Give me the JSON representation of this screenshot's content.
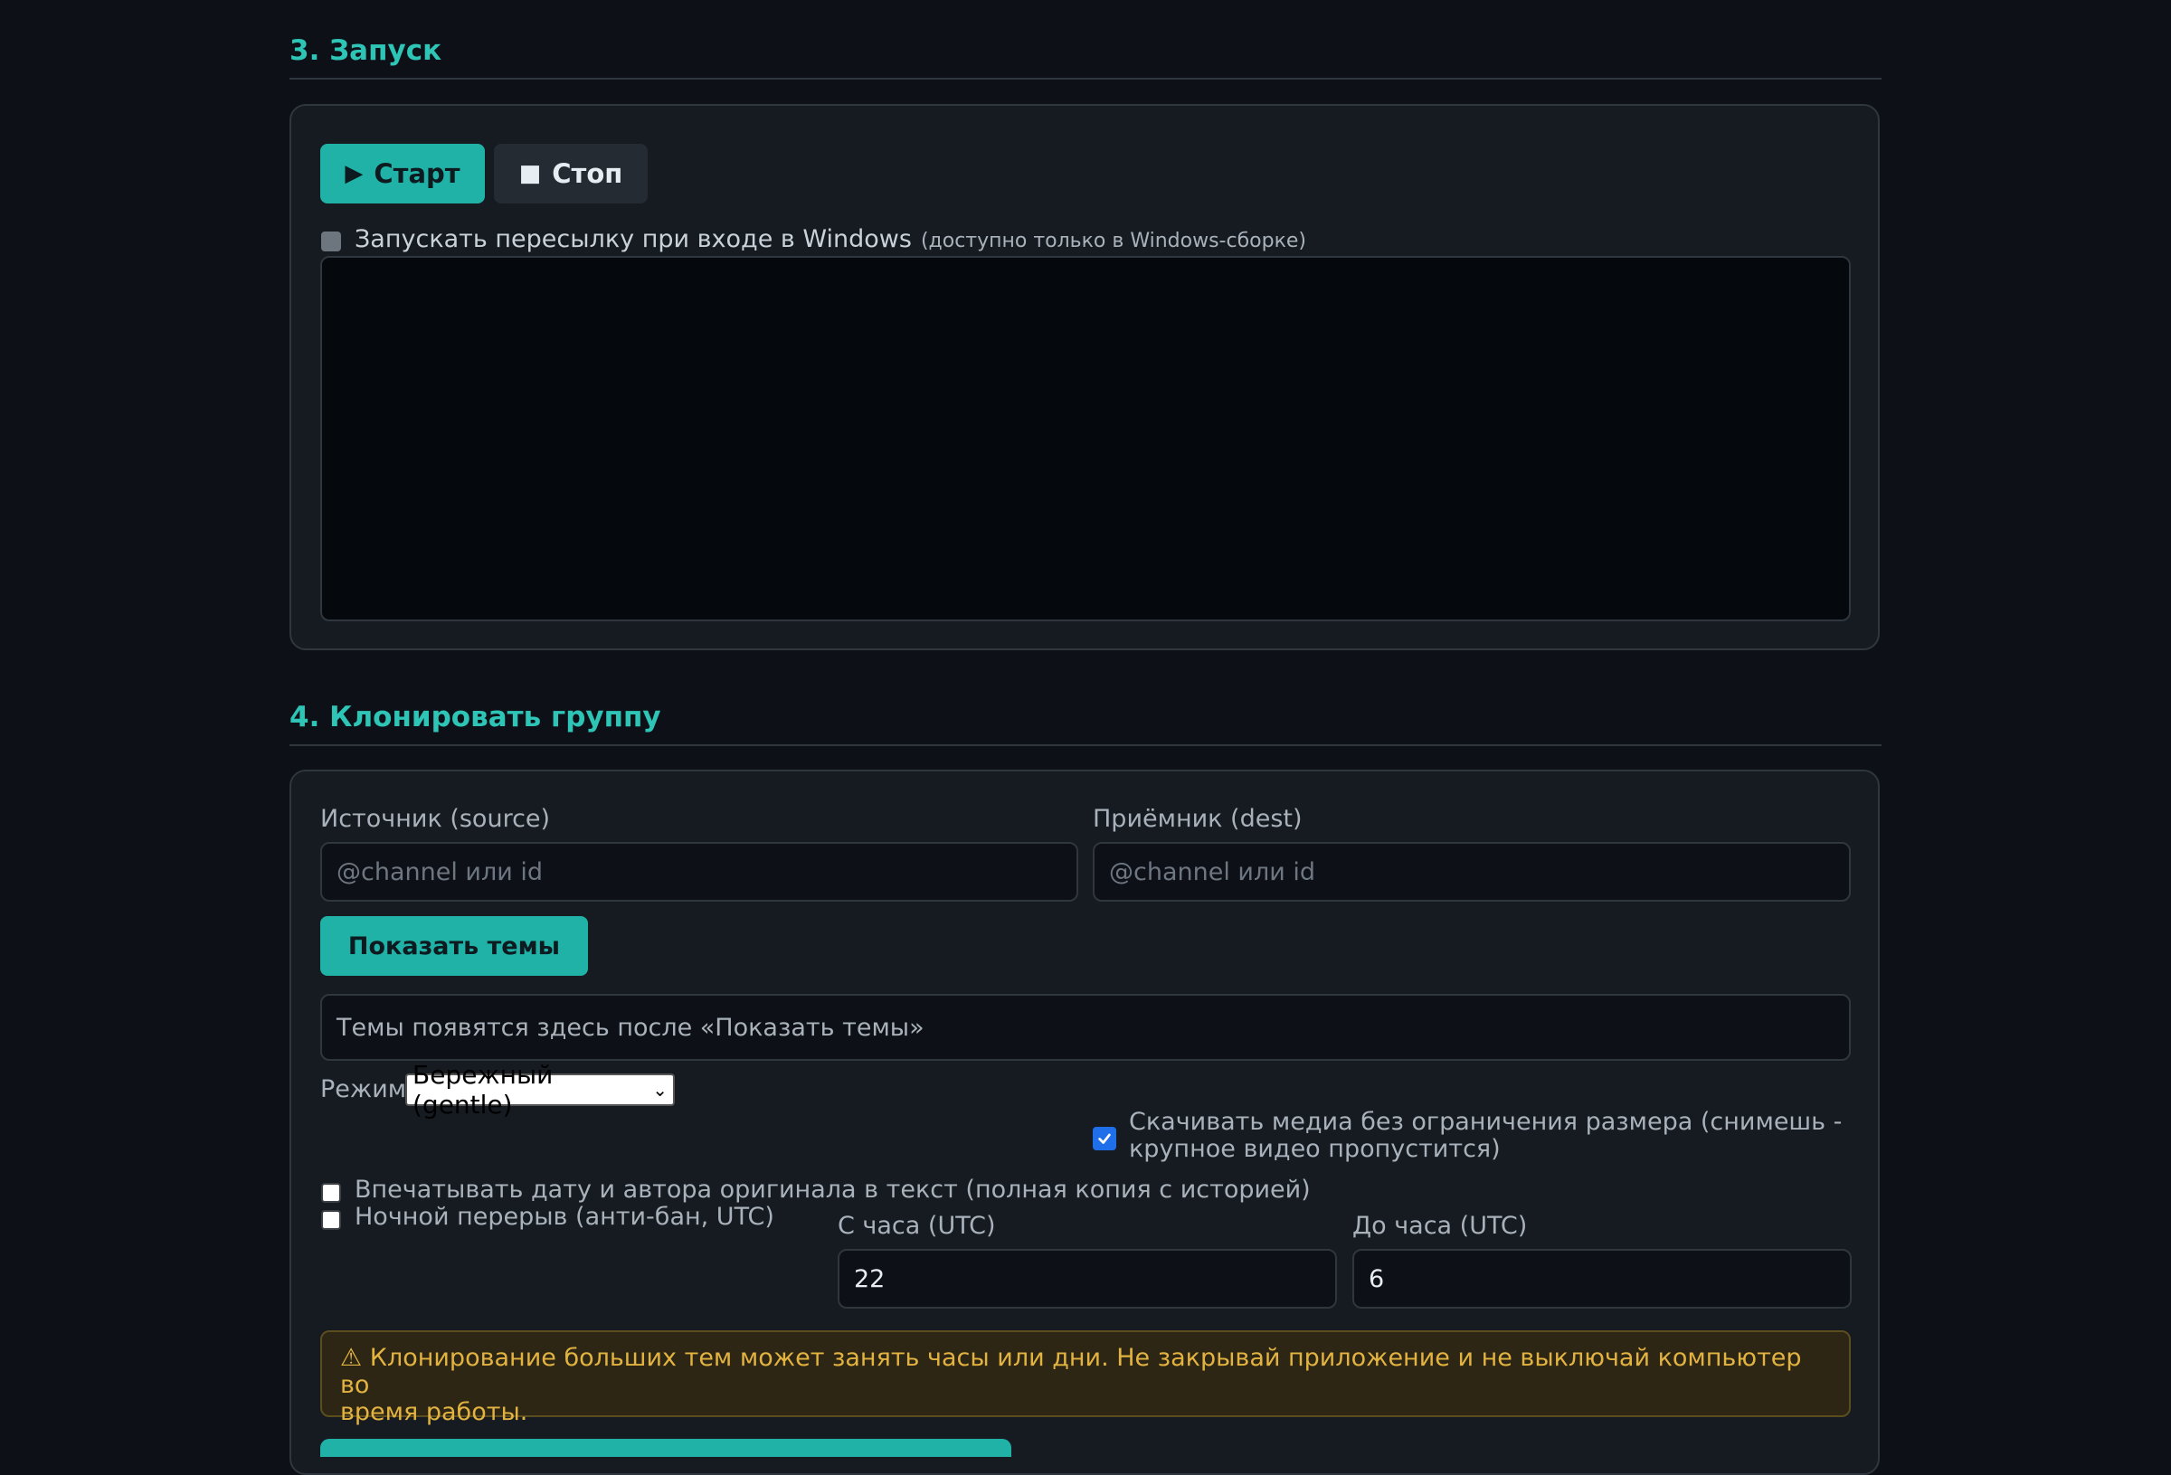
{
  "launch": {
    "title": "3. Запуск",
    "start_label": "Старт",
    "stop_label": "Стоп",
    "start_glyph": "▶",
    "stop_glyph": "■",
    "autostart_label": "Запускать пересылку при входе в Windows",
    "autostart_note": "(доступно только в Windows-сборке)",
    "autostart_checked": false,
    "autostart_disabled": true,
    "console_text": ""
  },
  "clone": {
    "title": "4. Клонировать группу",
    "source_label": "Источник (source)",
    "source_placeholder": "@channel или id",
    "source_value": "",
    "dest_label": "Приёмник (dest)",
    "dest_placeholder": "@channel или id",
    "dest_value": "",
    "show_topics_label": "Показать темы",
    "topics_placeholder": "Темы появятся здесь после «Показать темы»",
    "mode_label": "Режим",
    "mode_selected": "Бережный (gentle)",
    "media_label_line1": "Скачивать медиа без ограничения размера (снимешь -",
    "media_label_line2": "крупное видео пропустится)",
    "media_checked": true,
    "stamp_label": "Впечатывать дату и автора оригинала в текст (полная копия с историей)",
    "stamp_checked": false,
    "night_label": "Ночной перерыв (анти-бан, UTC)",
    "night_checked": false,
    "from_hour_label": "С часа (UTC)",
    "from_hour_value": "22",
    "to_hour_label": "До часа (UTC)",
    "to_hour_value": "6",
    "warning_line1": "⚠ Клонирование больших тем может занять часы или дни. Не закрывай приложение и не выключай компьютер во",
    "warning_line2": "время работы."
  },
  "colors": {
    "accent": "#2ec4b6",
    "button_primary": "#20b2a6",
    "background": "#0d1117",
    "card": "#161b22",
    "warning_text": "#e3b341"
  }
}
